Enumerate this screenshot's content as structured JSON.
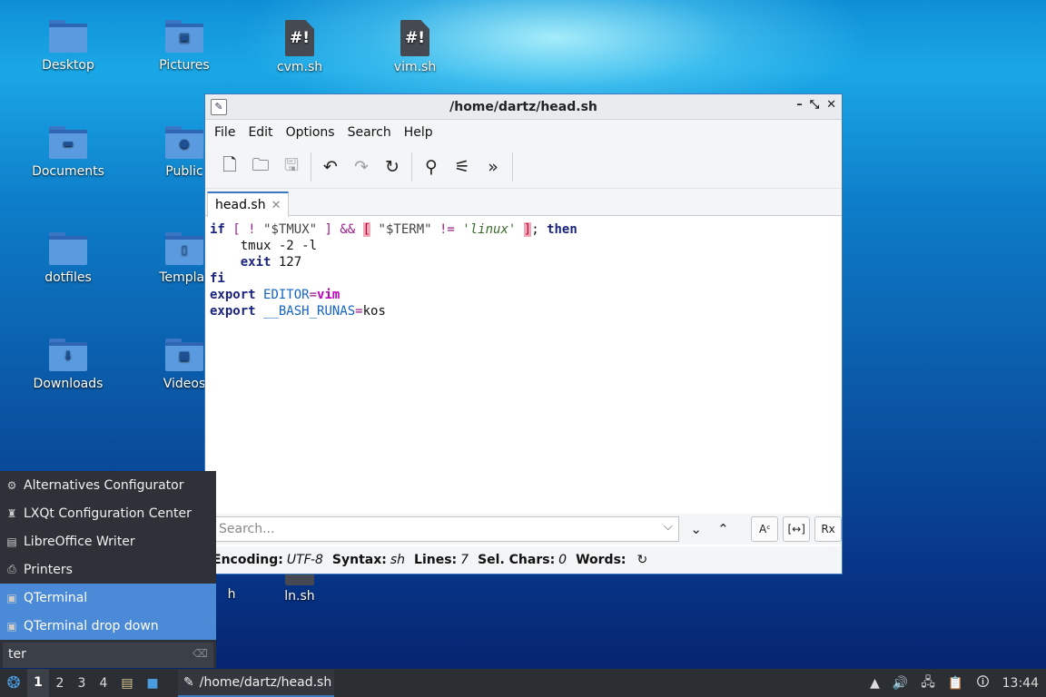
{
  "desktop": {
    "icons": [
      {
        "label": "Desktop",
        "kind": "folder",
        "glyph": ""
      },
      {
        "label": "Pictures",
        "kind": "folder",
        "glyph": "▣"
      },
      {
        "label": "cvm.sh",
        "kind": "script",
        "glyph": "#!"
      },
      {
        "label": "vim.sh",
        "kind": "script",
        "glyph": "#!"
      },
      {
        "label": "Documents",
        "kind": "folder",
        "glyph": "▬"
      },
      {
        "label": "Public",
        "kind": "folder",
        "glyph": "●"
      },
      {
        "label": "dotfiles",
        "kind": "folder",
        "glyph": ""
      },
      {
        "label": "Templat",
        "kind": "folder",
        "glyph": "▯"
      },
      {
        "label": "Downloads",
        "kind": "folder",
        "glyph": "⬇"
      },
      {
        "label": "Videos",
        "kind": "folder",
        "glyph": "■"
      },
      {
        "label": "h",
        "kind": "partial",
        "glyph": ""
      },
      {
        "label": "ln.sh",
        "kind": "script",
        "glyph": "#!"
      }
    ]
  },
  "window": {
    "title": "/home/dartz/head.sh",
    "menu": [
      "File",
      "Edit",
      "Options",
      "Search",
      "Help"
    ],
    "tab": {
      "label": "head.sh"
    },
    "search": {
      "placeholder": "Search..."
    },
    "status": {
      "encoding_label": "Encoding:",
      "encoding": "UTF-8",
      "syntax_label": "Syntax:",
      "syntax": "sh",
      "lines_label": "Lines:",
      "lines": "7",
      "sel_label": "Sel. Chars:",
      "sel": "0",
      "words_label": "Words:"
    },
    "option_buttons": [
      "Aᶜ",
      "[↔]",
      "Rx"
    ]
  },
  "code": {
    "l1": {
      "if": "if",
      "b1": "[",
      "bang": "!",
      "tmux": "\"$TMUX\"",
      "b2": "]",
      "and": "&&",
      "b3": "[",
      "term": "\"$TERM\"",
      "ne": "!=",
      "linux": "'linux'",
      "b4": "]",
      "semi": ";",
      "then": "then"
    },
    "l2": {
      "cmd": "tmux",
      "args": "-2 -l"
    },
    "l3": {
      "exit": "exit",
      "code": "127"
    },
    "l4": {
      "fi": "fi"
    },
    "l5": {
      "export": "export",
      "name": "EDITOR",
      "eq": "=",
      "val": "vim"
    },
    "l6": {
      "export": "export",
      "name": "__BASH_RUNAS",
      "eq": "=",
      "val": "kos"
    }
  },
  "startmenu": {
    "items": [
      {
        "label": "Alternatives Configurator",
        "icon": "⚙",
        "selected": false
      },
      {
        "label": "LXQt Configuration Center",
        "icon": "♜",
        "selected": false
      },
      {
        "label": "LibreOffice Writer",
        "icon": "▤",
        "selected": false
      },
      {
        "label": "Printers",
        "icon": "⎙",
        "selected": false
      },
      {
        "label": "QTerminal",
        "icon": "▣",
        "selected": true
      },
      {
        "label": "QTerminal drop down",
        "icon": "▣",
        "selected": true
      }
    ],
    "query": "ter"
  },
  "taskbar": {
    "workspaces": [
      "1",
      "2",
      "3",
      "4"
    ],
    "task": "/home/dartz/head.sh",
    "clock": "13:44"
  },
  "colors": {
    "accent": "#3b78c0",
    "selection": "#4b8ad6"
  }
}
